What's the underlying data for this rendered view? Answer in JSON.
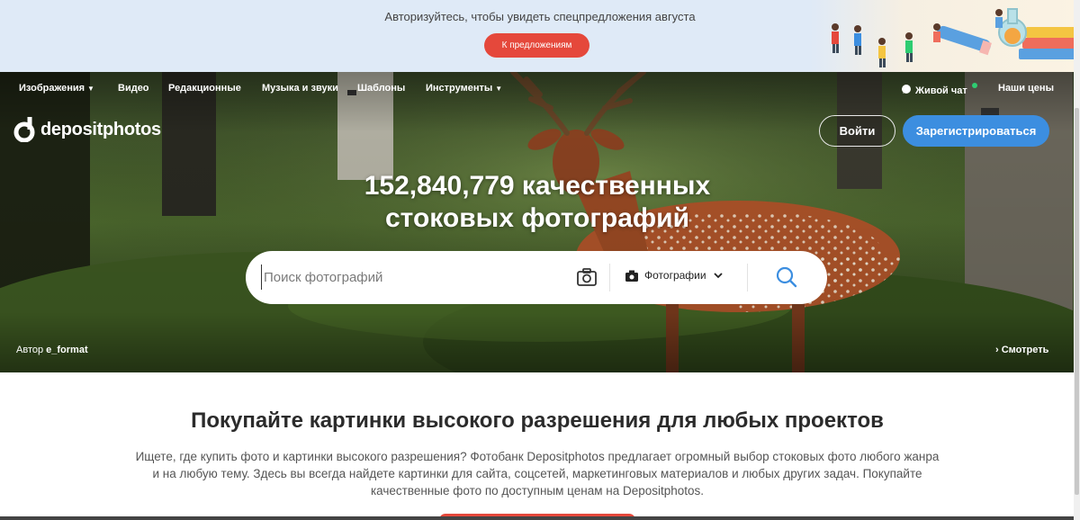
{
  "promo": {
    "text": "Авторизуйтесь, чтобы увидеть спецпредложения августа",
    "button": "К предложениям"
  },
  "nav": {
    "items": [
      {
        "label": "Изображения",
        "dropdown": true
      },
      {
        "label": "Видео",
        "dropdown": false
      },
      {
        "label": "Редакционные",
        "dropdown": false
      },
      {
        "label": "Музыка и звуки",
        "dropdown": false
      },
      {
        "label": "Шаблоны",
        "dropdown": false
      },
      {
        "label": "Инструменты",
        "dropdown": true
      }
    ],
    "live_chat": "Живой чат",
    "pricing": "Наши цены",
    "caret": "▼"
  },
  "header": {
    "logo_text": "depositphotos",
    "login": "Войти",
    "register": "Зарегистрироваться"
  },
  "hero": {
    "title_line1": "152,840,779 качественных",
    "title_line2": "стоковых фотографий",
    "author_prefix": "Автор",
    "author_name": "e_format",
    "view": "Смотреть",
    "view_chevron": "›"
  },
  "search": {
    "placeholder": "Поиск фотографий",
    "type_selected": "Фотографии"
  },
  "content": {
    "heading": "Покупайте картинки высокого разрешения для любых проектов",
    "description": "Ищете, где купить фото и картинки высокого разрешения? Фотобанк Depositphotos предлагает огромный выбор стоковых фото любого жанра и на любую тему. Здесь вы всегда найдете картинки для сайта, соцсетей, маркетинговых материалов и любых других задач. Покупайте качественные фото по доступным ценам на Depositphotos."
  },
  "colors": {
    "accent_red": "#e5483b",
    "accent_blue": "#3c8ee0",
    "promo_bg": "#dfeaf7",
    "online_dot": "#2ecc71"
  },
  "icons": [
    "camera-search-icon",
    "camera-icon",
    "chevron-down-icon",
    "search-icon",
    "chat-icon",
    "logo-icon",
    "chevron-right-icon"
  ]
}
